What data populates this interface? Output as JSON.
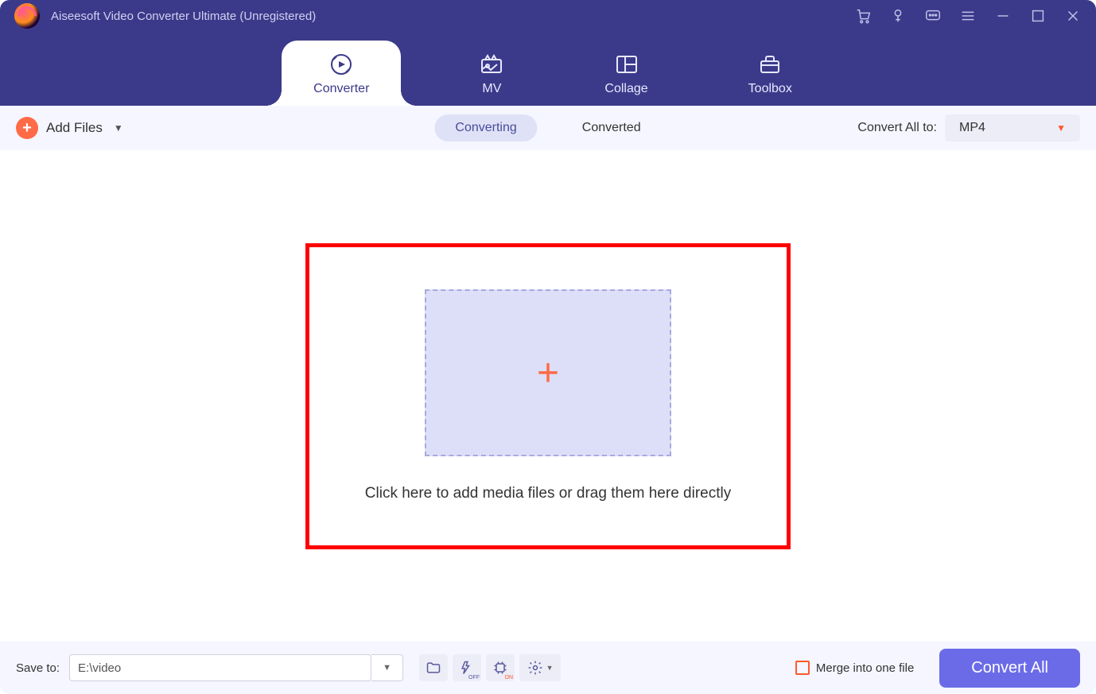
{
  "title": "Aiseesoft Video Converter Ultimate (Unregistered)",
  "mainTabs": {
    "converter": "Converter",
    "mv": "MV",
    "collage": "Collage",
    "toolbox": "Toolbox"
  },
  "toolbar": {
    "addFiles": "Add Files",
    "converting": "Converting",
    "converted": "Converted",
    "convertAllTo": "Convert All to:",
    "format": "MP4"
  },
  "dropzone": {
    "text": "Click here to add media files or drag them here directly"
  },
  "footer": {
    "saveTo": "Save to:",
    "path": "E:\\video",
    "mergeLabel": "Merge into one file",
    "convertAll": "Convert All"
  }
}
